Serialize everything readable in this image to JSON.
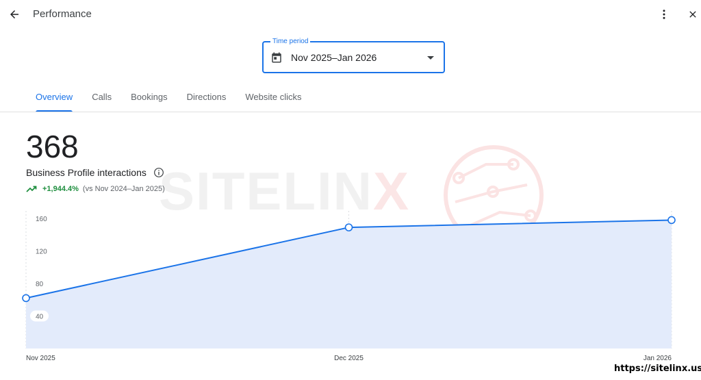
{
  "header": {
    "title": "Performance"
  },
  "time_period": {
    "label": "Time period",
    "value": "Nov 2025–Jan 2026"
  },
  "tabs": [
    {
      "label": "Overview",
      "active": true
    },
    {
      "label": "Calls",
      "active": false
    },
    {
      "label": "Bookings",
      "active": false
    },
    {
      "label": "Directions",
      "active": false
    },
    {
      "label": "Website clicks",
      "active": false
    }
  ],
  "metric": {
    "value": "368",
    "label": "Business Profile interactions",
    "change": "+1,944.4%",
    "comparison": "(vs Nov 2024–Jan 2025)"
  },
  "watermark": {
    "text_main": "SITELIN",
    "text_accent": "X"
  },
  "footer": {
    "url": "https://sitelinx.us"
  },
  "colors": {
    "accent": "#1a73e8",
    "positive": "#1e8e3e",
    "area_fill": "#e3ebfb"
  },
  "icons": [
    "back-arrow-icon",
    "more-vert-icon",
    "close-icon",
    "calendar-icon",
    "dropdown-caret-icon",
    "info-icon",
    "trending-up-icon"
  ],
  "chart_data": {
    "type": "area",
    "x": [
      "Nov 2025",
      "Dec 2025",
      "Jan 2026"
    ],
    "series": [
      {
        "values": [
          62,
          149,
          158
        ]
      }
    ],
    "yticks": [
      40,
      80,
      120,
      160
    ],
    "ylim": [
      0,
      170
    ],
    "grid": false
  }
}
